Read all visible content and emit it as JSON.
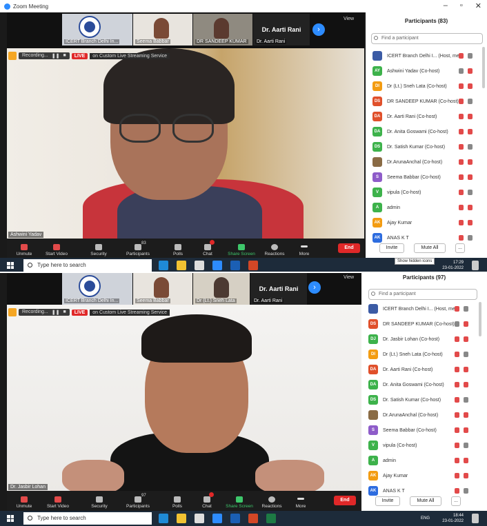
{
  "shot1": {
    "window_title": "Zoom Meeting",
    "thumbs": [
      "ICERT Branch Delhi In...",
      "Seema Babbar",
      "DR SANDEEP KUMAR",
      "Dr. Aarti Rani"
    ],
    "view_label": "View",
    "recording": "Recording...",
    "live": "LIVE",
    "stream_service": "on Custom Live Streaming Service",
    "speaker_name": "Ashwini Yadav",
    "controls": {
      "unmute": "Unmute",
      "start_video": "Start Video",
      "security": "Security",
      "participants": "Participants",
      "participants_count": "83",
      "polls": "Polls",
      "chat": "Chat",
      "share": "Share Screen",
      "reactions": "Reactions",
      "more": "More",
      "end": "End"
    },
    "panel": {
      "title": "Participants (83)",
      "search_placeholder": "Find a participant",
      "rows": [
        {
          "initials": "",
          "name": "ICERT Branch Delhi I... (Host, me)",
          "color": "#3b5ba5"
        },
        {
          "initials": "AY",
          "name": "Ashwini Yadav (Co-host)",
          "color": "#3db24b"
        },
        {
          "initials": "DI",
          "name": "Dr (Lt.) Sneh Lata (Co-host)",
          "color": "#f39c12"
        },
        {
          "initials": "DS",
          "name": "DR SANDEEP KUMAR (Co-host)",
          "color": "#e0502b"
        },
        {
          "initials": "DA",
          "name": "Dr. Aarti Rani (Co-host)",
          "color": "#e0502b"
        },
        {
          "initials": "DA",
          "name": "Dr. Anita Goswami (Co-host)",
          "color": "#3db24b"
        },
        {
          "initials": "DS",
          "name": "Dr. Satish Kumar (Co-host)",
          "color": "#3db24b"
        },
        {
          "initials": "",
          "name": "Dr.ArunaAnchal (Co-host)",
          "color": "#8a6b45"
        },
        {
          "initials": "S",
          "name": "Seema Babbar (Co-host)",
          "color": "#8e5cc9"
        },
        {
          "initials": "V",
          "name": "vipula (Co-host)",
          "color": "#3db24b"
        },
        {
          "initials": "A",
          "name": "admin",
          "color": "#3db24b"
        },
        {
          "initials": "AK",
          "name": "Ajay Kumar",
          "color": "#f39c12"
        },
        {
          "initials": "AK",
          "name": "ANAS K T",
          "color": "#2d6cdf"
        }
      ],
      "invite": "Invite",
      "mute_all": "Mute All",
      "more": "..."
    },
    "taskbar": {
      "search": "Type here to search",
      "tooltip": "Show hidden icons",
      "time": "17:29",
      "date": "23-01-2022"
    }
  },
  "shot2": {
    "thumbs": [
      "ICERT Branch Delhi In...",
      "Seema Babbar",
      "Dr (Lt.) Sneh Lata",
      "Dr. Aarti Rani"
    ],
    "view_label": "View",
    "recording": "Recording...",
    "live": "LIVE",
    "stream_service": "on Custom Live Streaming Service",
    "speaker_name": "Dr. Jasbir Lohan",
    "controls": {
      "unmute": "Unmute",
      "start_video": "Start Video",
      "security": "Security",
      "participants": "Participants",
      "participants_count": "97",
      "polls": "Polls",
      "chat": "Chat",
      "share": "Share Screen",
      "reactions": "Reactions",
      "more": "More",
      "end": "End"
    },
    "panel": {
      "title": "Participants (97)",
      "search_placeholder": "Find a participant",
      "rows": [
        {
          "initials": "",
          "name": "ICERT Branch Delhi I... (Host, me)",
          "color": "#3b5ba5"
        },
        {
          "initials": "DS",
          "name": "DR SANDEEP KUMAR (Co-host)",
          "color": "#e0502b"
        },
        {
          "initials": "DJ",
          "name": "Dr. Jasbir Lohan (Co-host)",
          "color": "#3db24b"
        },
        {
          "initials": "DI",
          "name": "Dr (Lt.) Sneh Lata (Co-host)",
          "color": "#f39c12"
        },
        {
          "initials": "DA",
          "name": "Dr. Aarti Rani (Co-host)",
          "color": "#e0502b"
        },
        {
          "initials": "DA",
          "name": "Dr. Anita Goswami (Co-host)",
          "color": "#3db24b"
        },
        {
          "initials": "DS",
          "name": "Dr. Satish Kumar (Co-host)",
          "color": "#3db24b"
        },
        {
          "initials": "",
          "name": "Dr.ArunaAnchal (Co-host)",
          "color": "#8a6b45"
        },
        {
          "initials": "S",
          "name": "Seema Babbar (Co-host)",
          "color": "#8e5cc9"
        },
        {
          "initials": "V",
          "name": "vipula (Co-host)",
          "color": "#3db24b"
        },
        {
          "initials": "A",
          "name": "admin",
          "color": "#3db24b"
        },
        {
          "initials": "AK",
          "name": "Ajay Kumar",
          "color": "#f39c12"
        },
        {
          "initials": "AK",
          "name": "ANAS K T",
          "color": "#2d6cdf"
        }
      ],
      "invite": "Invite",
      "mute_all": "Mute All",
      "more": "..."
    },
    "taskbar": {
      "search": "Type here to search",
      "lang": "ENG",
      "time": "18:44",
      "date": "23-01-2022"
    }
  }
}
